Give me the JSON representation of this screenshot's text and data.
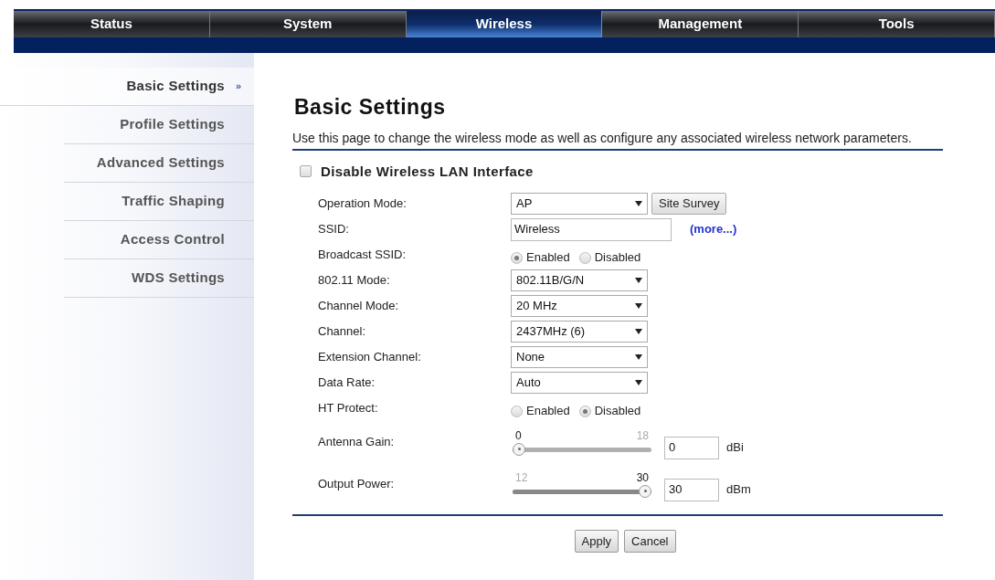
{
  "nav_tabs": [
    {
      "label": "Status",
      "selected": false
    },
    {
      "label": "System",
      "selected": false
    },
    {
      "label": "Wireless",
      "selected": true
    },
    {
      "label": "Management",
      "selected": false
    },
    {
      "label": "Tools",
      "selected": false
    }
  ],
  "sidebar": {
    "items": [
      {
        "label": "Basic Settings",
        "marker": "»",
        "selected": true
      },
      {
        "label": "Profile Settings",
        "selected": false
      },
      {
        "label": "Advanced Settings",
        "selected": false
      },
      {
        "label": "Traffic Shaping",
        "selected": false
      },
      {
        "label": "Access Control",
        "selected": false
      },
      {
        "label": "WDS Settings",
        "selected": false
      }
    ]
  },
  "page": {
    "title": "Basic Settings",
    "description": "Use this page to change the wireless mode as well as configure any associated wireless network parameters.",
    "disable_checkbox": {
      "label": "Disable Wireless LAN Interface",
      "checked": false
    }
  },
  "fields": [
    {
      "kind": "select",
      "label": "Operation Mode:",
      "value": "AP",
      "button": "Site Survey"
    },
    {
      "kind": "text",
      "label": "SSID:",
      "value": "Wireless",
      "link": "(more...)"
    },
    {
      "kind": "radio",
      "label": "Broadcast SSID:",
      "options": [
        {
          "label": "Enabled",
          "selected": true
        },
        {
          "label": "Disabled",
          "selected": false
        }
      ]
    },
    {
      "kind": "select",
      "label": "802.11 Mode:",
      "value": "802.11B/G/N"
    },
    {
      "kind": "select",
      "label": "Channel Mode:",
      "value": "20 MHz"
    },
    {
      "kind": "select",
      "label": "Channel:",
      "value": "2437MHz (6)"
    },
    {
      "kind": "select",
      "label": "Extension Channel:",
      "value": "None"
    },
    {
      "kind": "select",
      "label": "Data Rate:",
      "value": "Auto"
    },
    {
      "kind": "radio",
      "label": "HT Protect:",
      "options": [
        {
          "label": "Enabled",
          "selected": false
        },
        {
          "label": "Disabled",
          "selected": true
        }
      ]
    },
    {
      "kind": "slider",
      "label": "Antenna Gain:",
      "min_label": "0",
      "max_label": "18",
      "level": 0,
      "value": "0",
      "unit": "dBi"
    },
    {
      "kind": "slider",
      "label": "Output Power:",
      "min_label": "12",
      "max_label": "30",
      "level": 1,
      "value": "30",
      "unit": "dBm"
    }
  ],
  "buttons": [
    "Apply",
    "Cancel"
  ]
}
